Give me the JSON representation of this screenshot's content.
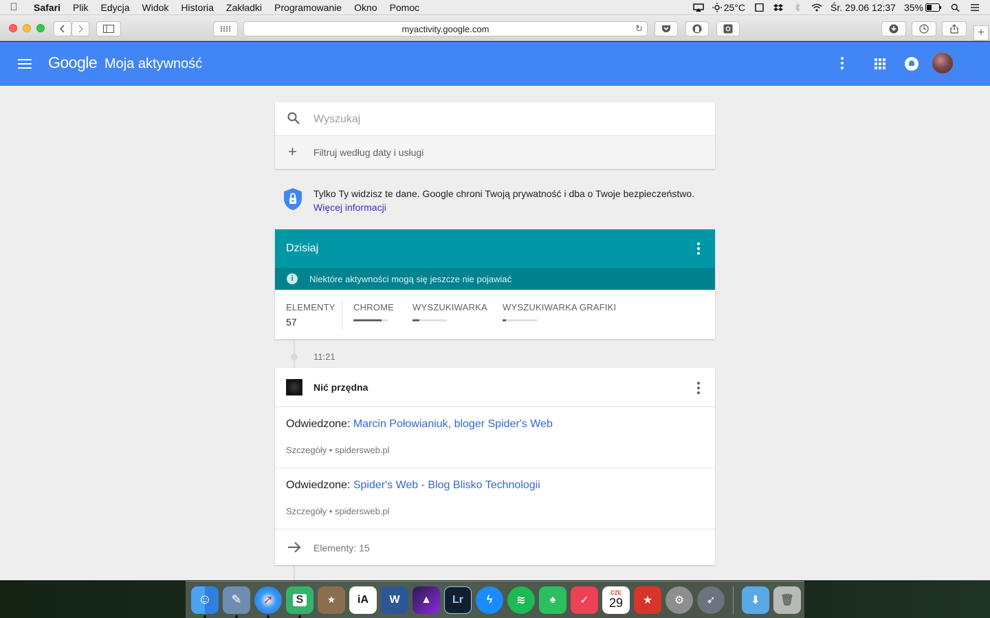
{
  "menubar": {
    "app_name": "Safari",
    "items": [
      "Plik",
      "Edycja",
      "Widok",
      "Historia",
      "Zakładki",
      "Programowanie",
      "Okno",
      "Pomoc"
    ],
    "weather": "25°C",
    "datetime": "Śr. 29.06  12:37",
    "battery": "35%"
  },
  "browser": {
    "url": "myactivity.google.com"
  },
  "appbar": {
    "logo_text": "Google",
    "title": "Moja aktywność"
  },
  "search": {
    "placeholder": "Wyszukaj",
    "filter_label": "Filtruj według daty i usługi"
  },
  "privacy": {
    "text": "Tylko Ty widzisz te dane. Google chroni Twoją prywatność i dba o Twoje bezpieczeństwo.",
    "link": "Więcej informacji"
  },
  "today": {
    "title": "Dzisiaj",
    "notice": "Niektóre aktywności mogą się jeszcze nie pojawiać",
    "stats": {
      "elements_label": "ELEMENTY",
      "elements_value": "57",
      "bars": [
        {
          "label": "CHROME",
          "fraction": 0.82
        },
        {
          "label": "WYSZUKIWARKA",
          "fraction": 0.2
        },
        {
          "label": "WYSZUKIWARKA GRAFIKI",
          "fraction": 0.1
        }
      ]
    }
  },
  "timeline": {
    "time": "11:21"
  },
  "activity": {
    "site_title": "Nić przędna",
    "entries": [
      {
        "prefix": "Odwiedzone:",
        "link": "Marcin Połowianiuk, bloger Spider's Web",
        "details": "Szczegóły",
        "separator": "•",
        "domain": "spidersweb.pl"
      },
      {
        "prefix": "Odwiedzone:",
        "link": "Spider's Web - Blog Blisko Technologii",
        "details": "Szczegóły",
        "separator": "•",
        "domain": "spidersweb.pl"
      }
    ],
    "more_label": "Elementy: 15"
  },
  "colors": {
    "appbar": "#4285f4",
    "today_header": "#0097a7",
    "notice_bar": "#00838f",
    "link": "#3367d6"
  },
  "dock": {
    "apps": [
      "finder-icon",
      "preview-icon",
      "safari-icon",
      "s-app-icon",
      "box-app-icon",
      "ia-writer-icon",
      "word-icon",
      "affinity-icon",
      "lightroom-icon",
      "messenger-icon",
      "spotify-icon",
      "evernote-icon",
      "pocket-icon",
      "calendar-icon",
      "wunderlist-icon",
      "system-preferences-icon",
      "launchpad-icon",
      "downloads-folder-icon",
      "trash-icon"
    ],
    "calendar_day": "29",
    "calendar_month": "CZE"
  }
}
